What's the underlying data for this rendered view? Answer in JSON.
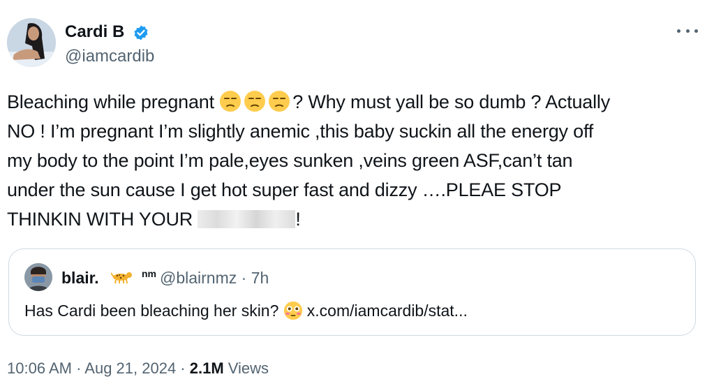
{
  "author": {
    "name": "Cardi B",
    "handle": "@iamcardib",
    "verified_color": "#1d9bf0"
  },
  "tweet": {
    "line1_before": "Bleaching while pregnant ",
    "line1_after": "? Why must yall be so dumb ? Actually",
    "line2": "NO ! I’m pregnant I’m slightly anemic ,this baby suckin all the energy off",
    "line3": "my body to the point I’m pale,eyes sunken ,veins green ASF,can’t tan",
    "line4": "under the sun cause I get hot super fast and dizzy ….PLEAE STOP",
    "line5_before": "THINKIN WITH YOUR ",
    "line5_after": "!"
  },
  "quote": {
    "name": "blair.",
    "nm": "nm",
    "handle_time": "@blairnmz · 7h",
    "text_before": "Has Cardi been bleaching her skin? ",
    "link": "x.com/iamcardib/stat..."
  },
  "meta": {
    "time_date": "10:06 AM · Aug 21, 2024 · ",
    "views_count": "2.1M",
    "views_label": " Views"
  },
  "icons": {
    "more": "more-icon",
    "verified": "verified-badge-icon",
    "unamused": "unamused-face-icon",
    "flushed": "flushed-face-icon",
    "leopard": "leopard-icon"
  }
}
